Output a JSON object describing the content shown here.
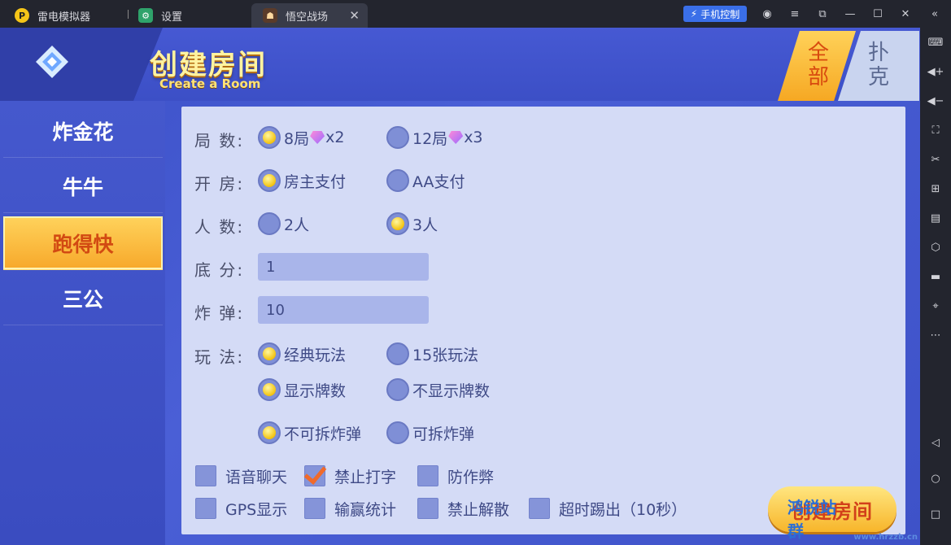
{
  "window": {
    "tabs": [
      {
        "label": "雷电模拟器"
      },
      {
        "label": "设置"
      },
      {
        "label": "悟空战场"
      }
    ],
    "phone_control": "手机控制"
  },
  "header": {
    "title": "创建房间",
    "subtitle": "Create a Room",
    "categories": [
      "全部",
      "扑克"
    ]
  },
  "sidebar": {
    "items": [
      "炸金花",
      "牛牛",
      "跑得快",
      "三公"
    ],
    "active_index": 2
  },
  "form": {
    "rounds": {
      "label": "局 数:",
      "options": [
        {
          "text": "8局",
          "multiplier": "x2",
          "selected": true
        },
        {
          "text": "12局",
          "multiplier": "x3",
          "selected": false
        }
      ]
    },
    "payment": {
      "label": "开 房:",
      "options": [
        {
          "text": "房主支付",
          "selected": true
        },
        {
          "text": "AA支付",
          "selected": false
        }
      ]
    },
    "players": {
      "label": "人 数:",
      "options": [
        {
          "text": "2人",
          "selected": false
        },
        {
          "text": "3人",
          "selected": true
        }
      ]
    },
    "base_score": {
      "label": "底 分:",
      "value": "1"
    },
    "bomb": {
      "label": "炸 弹:",
      "value": "10"
    },
    "rules": {
      "label": "玩 法:",
      "options": [
        {
          "text": "经典玩法",
          "selected": true
        },
        {
          "text": "15张玩法",
          "selected": false
        },
        {
          "text": "显示牌数",
          "selected": true
        },
        {
          "text": "不显示牌数",
          "selected": false
        },
        {
          "text": "不可拆炸弹",
          "selected": true
        },
        {
          "text": "可拆炸弹",
          "selected": false
        }
      ]
    },
    "checkboxes": [
      {
        "text": "语音聊天",
        "checked": false
      },
      {
        "text": "禁止打字",
        "checked": true
      },
      {
        "text": "防作弊",
        "checked": false
      },
      {
        "text": "GPS显示",
        "checked": false
      },
      {
        "text": "输赢统计",
        "checked": false
      },
      {
        "text": "禁止解散",
        "checked": false
      },
      {
        "text": "超时踢出（10秒）",
        "checked": false
      }
    ]
  },
  "create_button": "创建房间",
  "watermark": {
    "text": "鸿锐站群",
    "url": "www.hrzzb.cn"
  }
}
